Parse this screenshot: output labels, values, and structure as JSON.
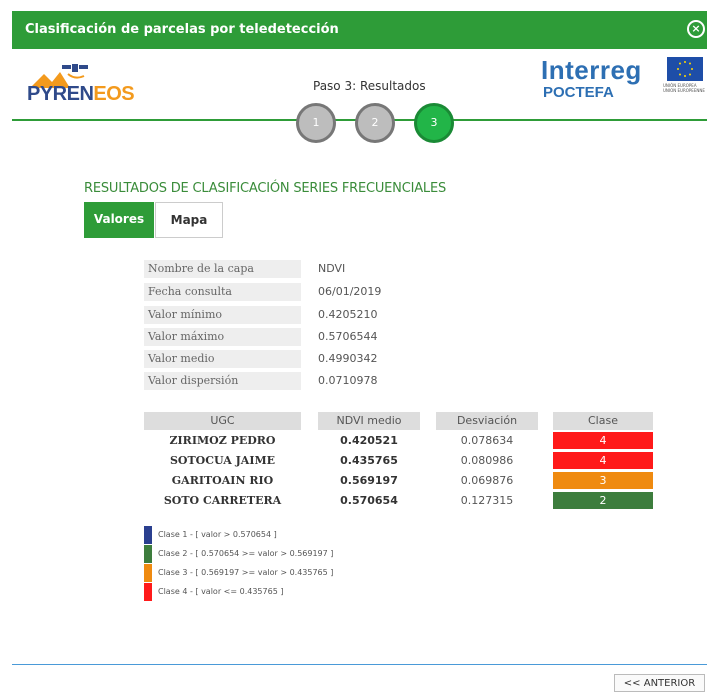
{
  "window": {
    "title": "Clasificación de parcelas por teledetección"
  },
  "logos": {
    "left_part1": "PYREN",
    "left_part2": "EOS",
    "right_brand": "Interreg",
    "right_sub": "POCTEFA",
    "right_flag_text": "UNIÓN EUROPEA UNION EUROPEENNE"
  },
  "wizard": {
    "label": "Paso 3: Resultados",
    "steps": [
      "1",
      "2",
      "3"
    ],
    "active_step": 3
  },
  "section": {
    "title": "RESULTADOS DE CLASIFICACIÓN SERIES FRECUENCIALES"
  },
  "tabs": [
    {
      "label": "Valores",
      "active": true
    },
    {
      "label": "Mapa",
      "active": false
    }
  ],
  "info": [
    {
      "key": "Nombre de la capa",
      "value": "NDVI"
    },
    {
      "key": "Fecha consulta",
      "value": "06/01/2019"
    },
    {
      "key": "Valor mínimo",
      "value": "0.4205210"
    },
    {
      "key": "Valor máximo",
      "value": "0.5706544"
    },
    {
      "key": "Valor medio",
      "value": "0.4990342"
    },
    {
      "key": "Valor dispersión",
      "value": "0.0710978"
    }
  ],
  "results": {
    "headers": [
      "UGC",
      "NDVI medio",
      "Desviación",
      "Clase"
    ],
    "rows": [
      {
        "ugc": "ZIRIMOZ PEDRO",
        "mean": "0.420521",
        "dev": "0.078634",
        "clase": "4",
        "color": "#ff1a1a"
      },
      {
        "ugc": "SOTOCUA JAIME",
        "mean": "0.435765",
        "dev": "0.080986",
        "clase": "4",
        "color": "#ff1a1a"
      },
      {
        "ugc": "GARITOAIN RIO",
        "mean": "0.569197",
        "dev": "0.069876",
        "clase": "3",
        "color": "#ef8a10"
      },
      {
        "ugc": "SOTO CARRETERA",
        "mean": "0.570654",
        "dev": "0.127315",
        "clase": "2",
        "color": "#3d7d3d"
      }
    ]
  },
  "legend": [
    {
      "label": "Clase 1 - [ valor > 0.570654 ]",
      "color": "#2a3f8f"
    },
    {
      "label": "Clase 2 - [ 0.570654 >= valor > 0.569197 ]",
      "color": "#3d7d3d"
    },
    {
      "label": "Clase 3 - [ 0.569197 >= valor > 0.435765 ]",
      "color": "#ef8a10"
    },
    {
      "label": "Clase 4 - [ valor <= 0.435765 ]",
      "color": "#ff1a1a"
    }
  ],
  "footer": {
    "prev_label": "<< ANTERIOR"
  }
}
